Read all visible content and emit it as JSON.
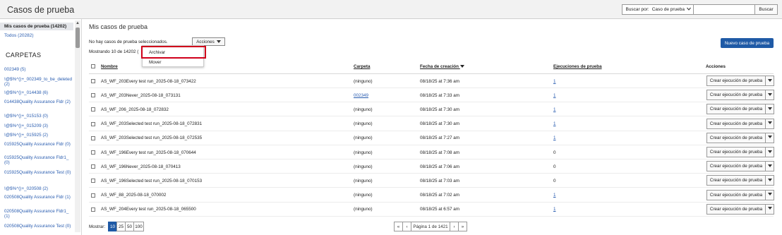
{
  "header": {
    "title": "Casos de prueba",
    "search_by_label": "Buscar por:",
    "search_by_value": "Caso de prueba",
    "search_input_value": "",
    "search_button": "Buscar"
  },
  "sidebar": {
    "selected": "Mis casos de prueba (14202)",
    "all": "Todos (20282)",
    "folders_heading": "CARPETAS",
    "folders": [
      "002349 (5)",
      "!@$%^()+_002349_to_be_deleted (2)",
      "!@$%^()+_014438 (6)",
      "014438Quality Assurance Fldr (2)",
      "!@$%^()+_015153 (0)",
      "!@$%^()+_015209 (3)",
      "!@$%^()+_015925 (2)",
      "015925Quality Assurance Fldr (0)",
      "015925Quality Assurance Fldr1_ (0)",
      "015925Quality Assurance Test (0)",
      "!@$%^()+_020508 (2)",
      "020508Quality Assurance Fldr (1)",
      "020508Quality Assurance Fldr1_ (1)",
      "020508Quality Assurance Test (0)"
    ]
  },
  "main": {
    "title": "Mis casos de prueba",
    "no_selection": "No hay casos de prueba seleccionados.",
    "actions_button": "Acciones",
    "showing": "Mostrando 10 de 14202 (",
    "new_button": "Nuevo caso de prueba",
    "menu": [
      "Archivar",
      "Mover"
    ],
    "columns": {
      "name": "Nombre",
      "folder": "Carpeta",
      "created": "Fecha de creación",
      "runs": "Ejecuciones de prueba",
      "actions": "Acciones"
    },
    "row_action": "Crear ejecución de prueba",
    "rows": [
      {
        "name": "AS_WF_203Every test run_2025-08-18_073422",
        "folder": "(ninguno)",
        "folder_link": false,
        "date": "08/18/25 at 7:36 am",
        "runs": "1",
        "runs_link": true
      },
      {
        "name": "AS_WF_203Never_2025-08-18_073131",
        "folder": "002349",
        "folder_link": true,
        "date": "08/18/25 at 7:33 am",
        "runs": "1",
        "runs_link": true
      },
      {
        "name": "AS_WF_206_2025-08-18_072832",
        "folder": "(ninguno)",
        "folder_link": false,
        "date": "08/18/25 at 7:30 am",
        "runs": "1",
        "runs_link": true
      },
      {
        "name": "AS_WF_203Selected test run_2025-08-18_072831",
        "folder": "(ninguno)",
        "folder_link": false,
        "date": "08/18/25 at 7:30 am",
        "runs": "1",
        "runs_link": true
      },
      {
        "name": "AS_WF_203Selected test run_2025-08-18_072535",
        "folder": "(ninguno)",
        "folder_link": false,
        "date": "08/18/25 at 7:27 am",
        "runs": "1",
        "runs_link": true
      },
      {
        "name": "AS_WF_196Every test run_2025-08-18_070644",
        "folder": "(ninguno)",
        "folder_link": false,
        "date": "08/18/25 at 7:08 am",
        "runs": "0",
        "runs_link": false
      },
      {
        "name": "AS_WF_196Never_2025-08-18_070413",
        "folder": "(ninguno)",
        "folder_link": false,
        "date": "08/18/25 at 7:06 am",
        "runs": "0",
        "runs_link": false
      },
      {
        "name": "AS_WF_196Selected test run_2025-08-18_070153",
        "folder": "(ninguno)",
        "folder_link": false,
        "date": "08/18/25 at 7:03 am",
        "runs": "0",
        "runs_link": false
      },
      {
        "name": "AS_WF_88_2025-08-18_070002",
        "folder": "(ninguno)",
        "folder_link": false,
        "date": "08/18/25 at 7:02 am",
        "runs": "1",
        "runs_link": true
      },
      {
        "name": "AS_WF_204Every test run_2025-08-18_065500",
        "folder": "(ninguno)",
        "folder_link": false,
        "date": "08/18/25 at 6:57 am",
        "runs": "1",
        "runs_link": true
      }
    ]
  },
  "footer": {
    "show_label": "Mostrar:",
    "page_sizes": [
      "10",
      "25",
      "50",
      "100"
    ],
    "active_size": "10",
    "page_text": "Página 1 de 1421",
    "first": "«",
    "prev": "‹",
    "next": "›",
    "last": "»"
  },
  "colors": {
    "accent": "#1f5aa6",
    "link": "#2a5db0",
    "highlight": "#d0011b"
  },
  "icons": {
    "dropdown": "caret-down-icon",
    "sort": "sort-desc-icon"
  }
}
